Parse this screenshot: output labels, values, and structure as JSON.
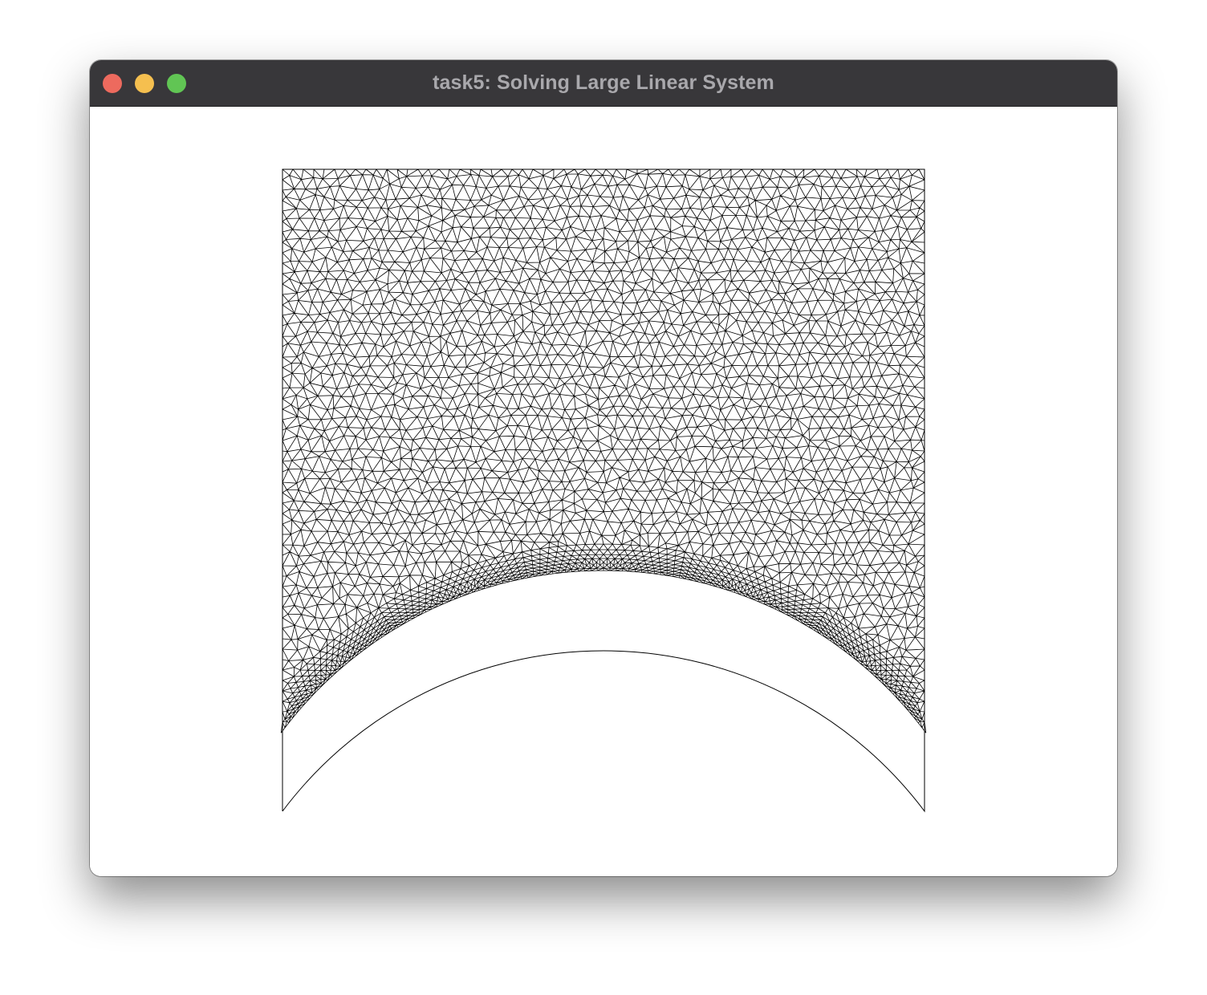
{
  "window": {
    "title": "task5: Solving Large Linear System",
    "buttons": {
      "close_color": "#ed6a5e",
      "minimize_color": "#f5bf4f",
      "maximize_color": "#61c554"
    }
  },
  "canvas": {
    "background": "#ffffff",
    "mesh_color": "#000000",
    "content": "triangulated mesh of a square with a circular arc cut-out at the bottom"
  }
}
